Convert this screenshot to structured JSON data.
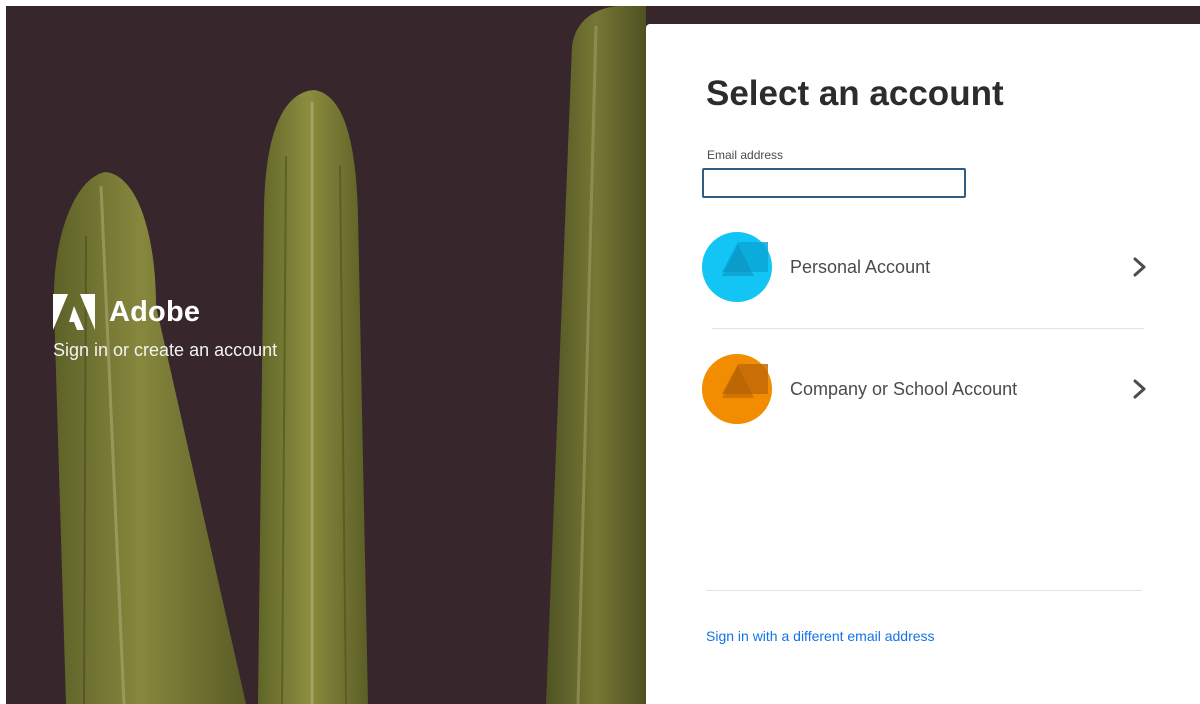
{
  "brand": {
    "name": "Adobe",
    "tagline": "Sign in or create an account",
    "logo_icon": "adobe-logo-icon"
  },
  "panel": {
    "title": "Select an account",
    "email": {
      "label": "Email address",
      "value": "",
      "placeholder": ""
    },
    "accounts": [
      {
        "label": "Personal Account",
        "avatar_color": "#12c5f5",
        "icon": "personal-account-avatar-icon"
      },
      {
        "label": "Company or School Account",
        "avatar_color": "#f28c00",
        "icon": "company-account-avatar-icon"
      }
    ],
    "alternate_link": "Sign in with a different email address"
  },
  "colors": {
    "hero_background": "#3d2a31",
    "cactus": "#9aa33b",
    "input_border": "#2f5d83",
    "link": "#1473e6",
    "title": "#2c2c2c"
  }
}
